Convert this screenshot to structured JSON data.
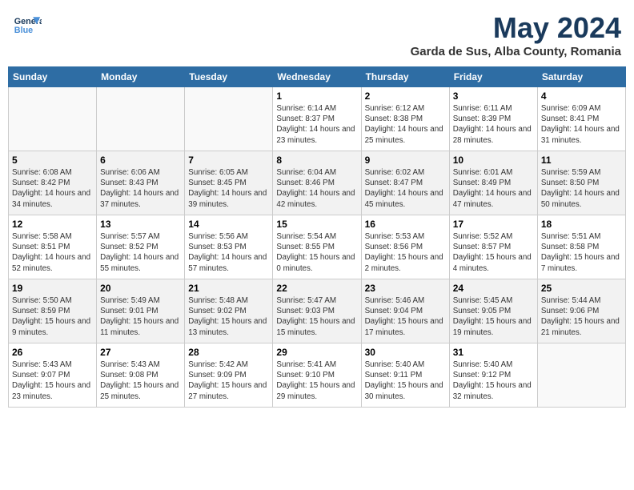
{
  "header": {
    "logo_line1": "General",
    "logo_line2": "Blue",
    "month_title": "May 2024",
    "location": "Garda de Sus, Alba County, Romania"
  },
  "days_of_week": [
    "Sunday",
    "Monday",
    "Tuesday",
    "Wednesday",
    "Thursday",
    "Friday",
    "Saturday"
  ],
  "weeks": [
    [
      {
        "day": "",
        "info": ""
      },
      {
        "day": "",
        "info": ""
      },
      {
        "day": "",
        "info": ""
      },
      {
        "day": "1",
        "info": "Sunrise: 6:14 AM\nSunset: 8:37 PM\nDaylight: 14 hours\nand 23 minutes."
      },
      {
        "day": "2",
        "info": "Sunrise: 6:12 AM\nSunset: 8:38 PM\nDaylight: 14 hours\nand 25 minutes."
      },
      {
        "day": "3",
        "info": "Sunrise: 6:11 AM\nSunset: 8:39 PM\nDaylight: 14 hours\nand 28 minutes."
      },
      {
        "day": "4",
        "info": "Sunrise: 6:09 AM\nSunset: 8:41 PM\nDaylight: 14 hours\nand 31 minutes."
      }
    ],
    [
      {
        "day": "5",
        "info": "Sunrise: 6:08 AM\nSunset: 8:42 PM\nDaylight: 14 hours\nand 34 minutes."
      },
      {
        "day": "6",
        "info": "Sunrise: 6:06 AM\nSunset: 8:43 PM\nDaylight: 14 hours\nand 37 minutes."
      },
      {
        "day": "7",
        "info": "Sunrise: 6:05 AM\nSunset: 8:45 PM\nDaylight: 14 hours\nand 39 minutes."
      },
      {
        "day": "8",
        "info": "Sunrise: 6:04 AM\nSunset: 8:46 PM\nDaylight: 14 hours\nand 42 minutes."
      },
      {
        "day": "9",
        "info": "Sunrise: 6:02 AM\nSunset: 8:47 PM\nDaylight: 14 hours\nand 45 minutes."
      },
      {
        "day": "10",
        "info": "Sunrise: 6:01 AM\nSunset: 8:49 PM\nDaylight: 14 hours\nand 47 minutes."
      },
      {
        "day": "11",
        "info": "Sunrise: 5:59 AM\nSunset: 8:50 PM\nDaylight: 14 hours\nand 50 minutes."
      }
    ],
    [
      {
        "day": "12",
        "info": "Sunrise: 5:58 AM\nSunset: 8:51 PM\nDaylight: 14 hours\nand 52 minutes."
      },
      {
        "day": "13",
        "info": "Sunrise: 5:57 AM\nSunset: 8:52 PM\nDaylight: 14 hours\nand 55 minutes."
      },
      {
        "day": "14",
        "info": "Sunrise: 5:56 AM\nSunset: 8:53 PM\nDaylight: 14 hours\nand 57 minutes."
      },
      {
        "day": "15",
        "info": "Sunrise: 5:54 AM\nSunset: 8:55 PM\nDaylight: 15 hours\nand 0 minutes."
      },
      {
        "day": "16",
        "info": "Sunrise: 5:53 AM\nSunset: 8:56 PM\nDaylight: 15 hours\nand 2 minutes."
      },
      {
        "day": "17",
        "info": "Sunrise: 5:52 AM\nSunset: 8:57 PM\nDaylight: 15 hours\nand 4 minutes."
      },
      {
        "day": "18",
        "info": "Sunrise: 5:51 AM\nSunset: 8:58 PM\nDaylight: 15 hours\nand 7 minutes."
      }
    ],
    [
      {
        "day": "19",
        "info": "Sunrise: 5:50 AM\nSunset: 8:59 PM\nDaylight: 15 hours\nand 9 minutes."
      },
      {
        "day": "20",
        "info": "Sunrise: 5:49 AM\nSunset: 9:01 PM\nDaylight: 15 hours\nand 11 minutes."
      },
      {
        "day": "21",
        "info": "Sunrise: 5:48 AM\nSunset: 9:02 PM\nDaylight: 15 hours\nand 13 minutes."
      },
      {
        "day": "22",
        "info": "Sunrise: 5:47 AM\nSunset: 9:03 PM\nDaylight: 15 hours\nand 15 minutes."
      },
      {
        "day": "23",
        "info": "Sunrise: 5:46 AM\nSunset: 9:04 PM\nDaylight: 15 hours\nand 17 minutes."
      },
      {
        "day": "24",
        "info": "Sunrise: 5:45 AM\nSunset: 9:05 PM\nDaylight: 15 hours\nand 19 minutes."
      },
      {
        "day": "25",
        "info": "Sunrise: 5:44 AM\nSunset: 9:06 PM\nDaylight: 15 hours\nand 21 minutes."
      }
    ],
    [
      {
        "day": "26",
        "info": "Sunrise: 5:43 AM\nSunset: 9:07 PM\nDaylight: 15 hours\nand 23 minutes."
      },
      {
        "day": "27",
        "info": "Sunrise: 5:43 AM\nSunset: 9:08 PM\nDaylight: 15 hours\nand 25 minutes."
      },
      {
        "day": "28",
        "info": "Sunrise: 5:42 AM\nSunset: 9:09 PM\nDaylight: 15 hours\nand 27 minutes."
      },
      {
        "day": "29",
        "info": "Sunrise: 5:41 AM\nSunset: 9:10 PM\nDaylight: 15 hours\nand 29 minutes."
      },
      {
        "day": "30",
        "info": "Sunrise: 5:40 AM\nSunset: 9:11 PM\nDaylight: 15 hours\nand 30 minutes."
      },
      {
        "day": "31",
        "info": "Sunrise: 5:40 AM\nSunset: 9:12 PM\nDaylight: 15 hours\nand 32 minutes."
      },
      {
        "day": "",
        "info": ""
      }
    ]
  ]
}
